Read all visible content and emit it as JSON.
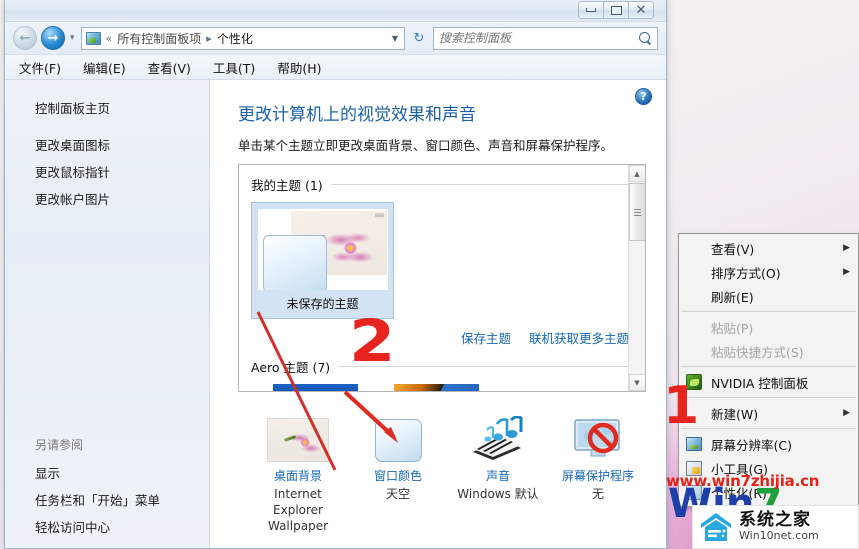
{
  "window": {
    "controls": {
      "minimize": "─",
      "maximize": "□",
      "close": "✕"
    }
  },
  "addressbar": {
    "back_icon": "back-arrow",
    "forward_icon": "forward-arrow",
    "history_caret": "▾",
    "breadcrumb_prefix": "«",
    "breadcrumb": [
      "所有控制面板项",
      "个性化"
    ],
    "breadcrumb_sep": "▸",
    "dropdown_caret": "▼",
    "refresh_icon": "↻"
  },
  "search": {
    "placeholder": "搜索控制面板",
    "value": "",
    "icon": "search-icon"
  },
  "menubar": {
    "items": [
      {
        "label": "文件(F)"
      },
      {
        "label": "编辑(E)"
      },
      {
        "label": "查看(V)"
      },
      {
        "label": "工具(T)"
      },
      {
        "label": "帮助(H)"
      }
    ]
  },
  "sidebar": {
    "home": "控制面板主页",
    "items": [
      {
        "label": "更改桌面图标"
      },
      {
        "label": "更改鼠标指针"
      },
      {
        "label": "更改帐户图片"
      }
    ],
    "also_see_heading": "另请参阅",
    "also_see": [
      {
        "label": "显示"
      },
      {
        "label": "任务栏和「开始」菜单"
      },
      {
        "label": "轻松访问中心"
      }
    ]
  },
  "content": {
    "help_icon": "?",
    "title": "更改计算机上的视觉效果和声音",
    "subtitle": "单击某个主题立即更改桌面背景、窗口颜色、声音和屏幕保护程序。",
    "groups": {
      "my_themes": "我的主题 (1)",
      "aero_themes": "Aero 主题 (7)"
    },
    "selected_theme": "未保存的主题",
    "links": [
      {
        "label": "保存主题"
      },
      {
        "label": "联机获取更多主题"
      }
    ],
    "scrollbar": {
      "up": "▲",
      "down": "▼"
    }
  },
  "settings_strip": [
    {
      "icon": "desktop-background-icon",
      "caption": "桌面背景",
      "value": "Internet Explorer Wallpaper"
    },
    {
      "icon": "window-color-icon",
      "caption": "窗口颜色",
      "value": "天空"
    },
    {
      "icon": "sounds-icon",
      "caption": "声音",
      "value": "Windows 默认"
    },
    {
      "icon": "screensaver-icon",
      "caption": "屏幕保护程序",
      "value": "无"
    }
  ],
  "context_menu": {
    "items": [
      {
        "label": "查看(V)",
        "submenu": true,
        "disabled": false,
        "icon": ""
      },
      {
        "label": "排序方式(O)",
        "submenu": true,
        "disabled": false,
        "icon": ""
      },
      {
        "label": "刷新(E)",
        "submenu": false,
        "disabled": false,
        "icon": ""
      },
      {
        "label": "粘贴(P)",
        "submenu": false,
        "disabled": true,
        "icon": ""
      },
      {
        "label": "粘贴快捷方式(S)",
        "submenu": false,
        "disabled": true,
        "icon": ""
      },
      {
        "label": "NVIDIA 控制面板",
        "submenu": false,
        "disabled": false,
        "icon": "nvidia-icon"
      },
      {
        "label": "新建(W)",
        "submenu": true,
        "disabled": false,
        "icon": ""
      },
      {
        "label": "屏幕分辨率(C)",
        "submenu": false,
        "disabled": false,
        "icon": "monitor-icon"
      },
      {
        "label": "小工具(G)",
        "submenu": false,
        "disabled": false,
        "icon": "gadget-icon"
      },
      {
        "label": "个性化(R)",
        "submenu": false,
        "disabled": false,
        "icon": "personalize-icon"
      }
    ],
    "arrow": "▶"
  },
  "annotations": {
    "marker_one": "1",
    "marker_two": "2"
  },
  "watermark": {
    "url": "www.win7zhijia.cn",
    "big_left": "Win",
    "big_right": "7",
    "logo_title": "系统之家",
    "logo_sub": "Win10net.com"
  },
  "colors": {
    "accent_blue": "#1668b4",
    "title_blue": "#1b5fa8",
    "annotation_red": "#e8241f",
    "watermark_red": "#e2231a"
  }
}
